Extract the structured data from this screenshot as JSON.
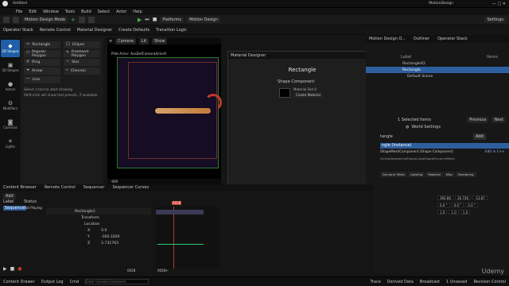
{
  "app": {
    "title": "MotionDesign",
    "project": "Untitled"
  },
  "menu": [
    "File",
    "Edit",
    "Window",
    "Tools",
    "Build",
    "Select",
    "Actor",
    "Help"
  ],
  "toolbar": {
    "mode": "Motion Design Mode",
    "platforms": "Platforms",
    "motion_design": "Motion Design",
    "settings": "Settings"
  },
  "tabs": [
    "Operator Stack",
    "Remote Control",
    "Material Designer",
    "Create Defaults",
    "Transition Logic"
  ],
  "sidebar": [
    {
      "label": "2D Shapes",
      "icon": "shapes-icon",
      "active": true
    },
    {
      "label": "3D Shapes",
      "icon": "cube-icon",
      "active": false
    },
    {
      "label": "Actors",
      "icon": "actor-icon",
      "active": false
    },
    {
      "label": "Modifiers",
      "icon": "modifier-icon",
      "active": false
    },
    {
      "label": "Cameras",
      "icon": "camera-icon",
      "active": false
    },
    {
      "label": "Lights",
      "icon": "light-icon",
      "active": false
    }
  ],
  "shapes": [
    "Rectangle",
    "Ellipse",
    "Regular Polygon",
    "Freehand Polygon",
    "Ring",
    "Star",
    "Arrow",
    "Chevron",
    "Line"
  ],
  "shapes_hint": [
    "Select a tool to start drawing",
    "Shift-click will show tool presets, if available"
  ],
  "viewport": {
    "camera": "Camera",
    "lit": "Lit",
    "show": "Show",
    "pilot": "Pilot Actor: AvaDefCameraActor0"
  },
  "material_designer": {
    "title": "Material Designer",
    "heading": "Rectangle",
    "section": "Shape Component",
    "slot": "Material Slot 0",
    "create_button": "Create Material"
  },
  "outliner": {
    "tabs": [
      "Motion Design O...",
      "Outliner",
      "Operator Stack"
    ],
    "col_label": "Label",
    "col_items": "Items",
    "rows": [
      {
        "label": "RectangleX2",
        "indent": 1,
        "selected": false
      },
      {
        "label": "Rectangle",
        "indent": 1,
        "selected": true
      },
      {
        "label": "Default Scene",
        "indent": 2,
        "selected": false
      }
    ],
    "count": "1 Selected Items",
    "prev": "Previous",
    "next": "Next"
  },
  "details": {
    "world_settings": "World Settings",
    "name": "tangle",
    "add": "Add",
    "instance": "ngle (Instance)",
    "component": "ShapeMeshComponent (Shape Component)",
    "edit": "Edit in C++",
    "path": "/Script/AvalancheShapes.AvaShapeDynamicMesh",
    "filters": [
      "Dynamic Mesh",
      "Lighting",
      "Material",
      "Misc",
      "Rendering"
    ],
    "values": {
      "loc": [
        "392.86",
        "26.736",
        "-13.87"
      ],
      "rot": [
        "0.0 °",
        "0.0 °",
        "0.0 °"
      ],
      "scale": [
        "1.0",
        "1.0",
        "1.0"
      ]
    }
  },
  "bottom": {
    "tabs": [
      "Content Browser",
      "Remote Control",
      "Sequencer",
      "Sequencer Curves"
    ],
    "track_add": "Add",
    "label_col": "Label",
    "status_col": "Status",
    "sequence": "Sequence",
    "not_playing": "Not Playing",
    "tracks": [
      "Rectangle1",
      "Transform",
      "Location",
      "X",
      "Y",
      "Z"
    ],
    "track_values": [
      "",
      "",
      "",
      "0.0",
      "-160.3200",
      "2.731763"
    ],
    "frame": "0028",
    "frame_left": "-009",
    "frame_right": "0028+"
  },
  "status": {
    "items": [
      "Content Drawer",
      "Output Log",
      "Cmd"
    ],
    "cmd_placeholder": "Enter Console Command",
    "right": [
      "Trace",
      "Derived Data",
      "Broadcast",
      "1 Unsaved",
      "Revision Control"
    ]
  },
  "watermark": "Udemy"
}
